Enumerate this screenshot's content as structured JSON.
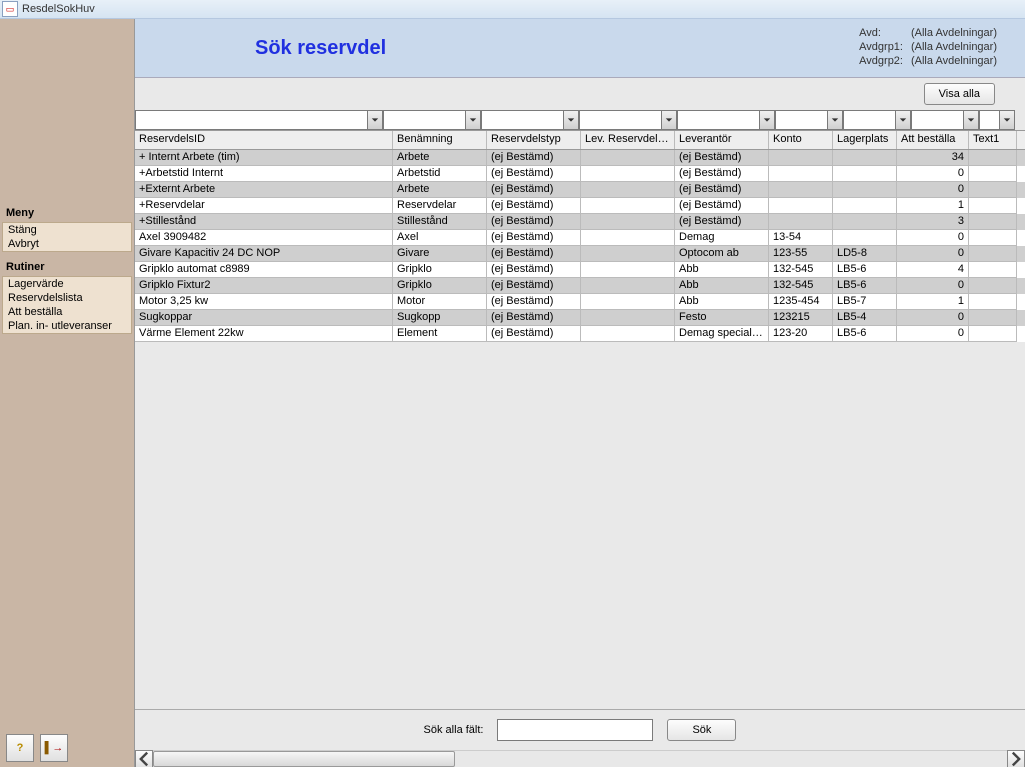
{
  "window": {
    "title": "ResdelSokHuv"
  },
  "sidebar": {
    "meny_header": "Meny",
    "meny_items": [
      "Stäng",
      "Avbryt"
    ],
    "rutiner_header": "Rutiner",
    "rutiner_items": [
      "Lagervärde",
      "Reservdelslista",
      "Att beställa",
      "Plan. in- utleveranser"
    ],
    "help_icon": "?",
    "exit_icon": "⇥"
  },
  "header": {
    "title": "Sök reservdel",
    "avd_label": "Avd:",
    "avd_value": "(Alla Avdelningar)",
    "avdgrp1_label": "Avdgrp1:",
    "avdgrp1_value": "(Alla Avdelningar)",
    "avdgrp2_label": "Avdgrp2:",
    "avdgrp2_value": "(Alla Avdelningar)"
  },
  "toolbar": {
    "visa_alla": "Visa alla"
  },
  "columns": [
    "ReservdelsID",
    "Benämning",
    "Reservdelstyp",
    "Lev. ReservdelsID",
    "Leverantör",
    "Konto",
    "Lagerplats",
    "Att beställa",
    "Text1"
  ],
  "rows": [
    {
      "id": "+  Internt Arbete (tim)",
      "ben": "Arbete",
      "typ": "(ej Bestämd)",
      "levid": "",
      "lev": "(ej Bestämd)",
      "konto": "",
      "lager": "",
      "best": "34",
      "t1": ""
    },
    {
      "id": "+Arbetstid Internt",
      "ben": "Arbetstid",
      "typ": "(ej Bestämd)",
      "levid": "",
      "lev": "(ej Bestämd)",
      "konto": "",
      "lager": "",
      "best": "0",
      "t1": ""
    },
    {
      "id": "+Externt Arbete",
      "ben": "Arbete",
      "typ": "(ej Bestämd)",
      "levid": "",
      "lev": "(ej Bestämd)",
      "konto": "",
      "lager": "",
      "best": "0",
      "t1": ""
    },
    {
      "id": "+Reservdelar",
      "ben": "Reservdelar",
      "typ": "(ej Bestämd)",
      "levid": "",
      "lev": "(ej Bestämd)",
      "konto": "",
      "lager": "",
      "best": "1",
      "t1": ""
    },
    {
      "id": "+Stillestånd",
      "ben": "Stillestånd",
      "typ": "(ej Bestämd)",
      "levid": "",
      "lev": "(ej Bestämd)",
      "konto": "",
      "lager": "",
      "best": "3",
      "t1": ""
    },
    {
      "id": "Axel 3909482",
      "ben": "Axel",
      "typ": "(ej Bestämd)",
      "levid": "",
      "lev": "Demag",
      "konto": "13-54",
      "lager": "",
      "best": "0",
      "t1": ""
    },
    {
      "id": "Givare Kapacitiv 24 DC NOP",
      "ben": "Givare",
      "typ": "(ej Bestämd)",
      "levid": "",
      "lev": "Optocom ab",
      "konto": "123-55",
      "lager": "LD5-8",
      "best": "0",
      "t1": ""
    },
    {
      "id": "Gripklo automat c8989",
      "ben": "Gripklo",
      "typ": "(ej Bestämd)",
      "levid": "",
      "lev": "Abb",
      "konto": "132-545",
      "lager": "LB5-6",
      "best": "4",
      "t1": ""
    },
    {
      "id": "Gripklo Fixtur2",
      "ben": "Gripklo",
      "typ": "(ej Bestämd)",
      "levid": "",
      "lev": "Abb",
      "konto": "132-545",
      "lager": "LB5-6",
      "best": "0",
      "t1": ""
    },
    {
      "id": "Motor 3,25 kw",
      "ben": "Motor",
      "typ": "(ej Bestämd)",
      "levid": "",
      "lev": "Abb",
      "konto": "1235-454",
      "lager": "LB5-7",
      "best": "1",
      "t1": ""
    },
    {
      "id": "Sugkoppar",
      "ben": "Sugkopp",
      "typ": "(ej Bestämd)",
      "levid": "",
      "lev": "Festo",
      "konto": "123215",
      "lager": "LB5-4",
      "best": "0",
      "t1": ""
    },
    {
      "id": "Värme Element 22kw",
      "ben": "Element",
      "typ": "(ej Bestämd)",
      "levid": "",
      "lev": "Demag specialisten",
      "konto": "123-20",
      "lager": "LB5-6",
      "best": "0",
      "t1": ""
    }
  ],
  "footer": {
    "sok_label": "Sök alla fält:",
    "sok_button": "Sök"
  }
}
